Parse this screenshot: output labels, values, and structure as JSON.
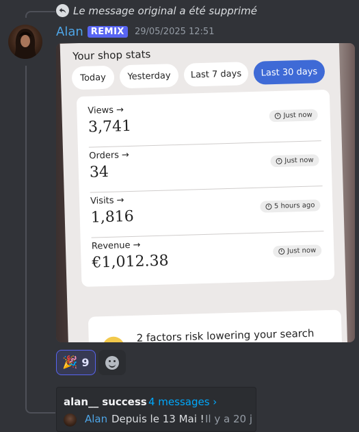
{
  "reply": {
    "text": "Le message original a été supprimé"
  },
  "message": {
    "author": "Alan",
    "badge": "REMIX",
    "timestamp": "29/05/2025 12:51"
  },
  "attachment": {
    "title": "Your shop stats",
    "tabs": [
      {
        "label": "Today",
        "active": false
      },
      {
        "label": "Yesterday",
        "active": false
      },
      {
        "label": "Last 7 days",
        "active": false
      },
      {
        "label": "Last 30 days",
        "active": true
      }
    ],
    "stats": [
      {
        "label": "Views",
        "value": "3,741",
        "time": "Just now"
      },
      {
        "label": "Orders",
        "value": "34",
        "time": "Just now"
      },
      {
        "label": "Visits",
        "value": "1,816",
        "time": "5 hours ago"
      },
      {
        "label": "Revenue",
        "value": "€1,012.38",
        "time": "Just now"
      }
    ],
    "warning": "2 factors risk lowering your search"
  },
  "reactions": [
    {
      "emoji": "🎉",
      "count": "9",
      "icon": "party-popper-icon"
    }
  ],
  "add_reaction_icon": "smiley-icon",
  "thread": {
    "name": "alan__ success",
    "count": "4 messages ›",
    "last_author": "Alan",
    "last_message": "Depuis le 13 Mai !",
    "last_time": "Il y a 20 j"
  },
  "colors": {
    "background": "#313338",
    "username": "#4ea5e6",
    "badge": "#5865f2",
    "link": "#00a8fc",
    "active_tab": "#3e6ad6"
  }
}
